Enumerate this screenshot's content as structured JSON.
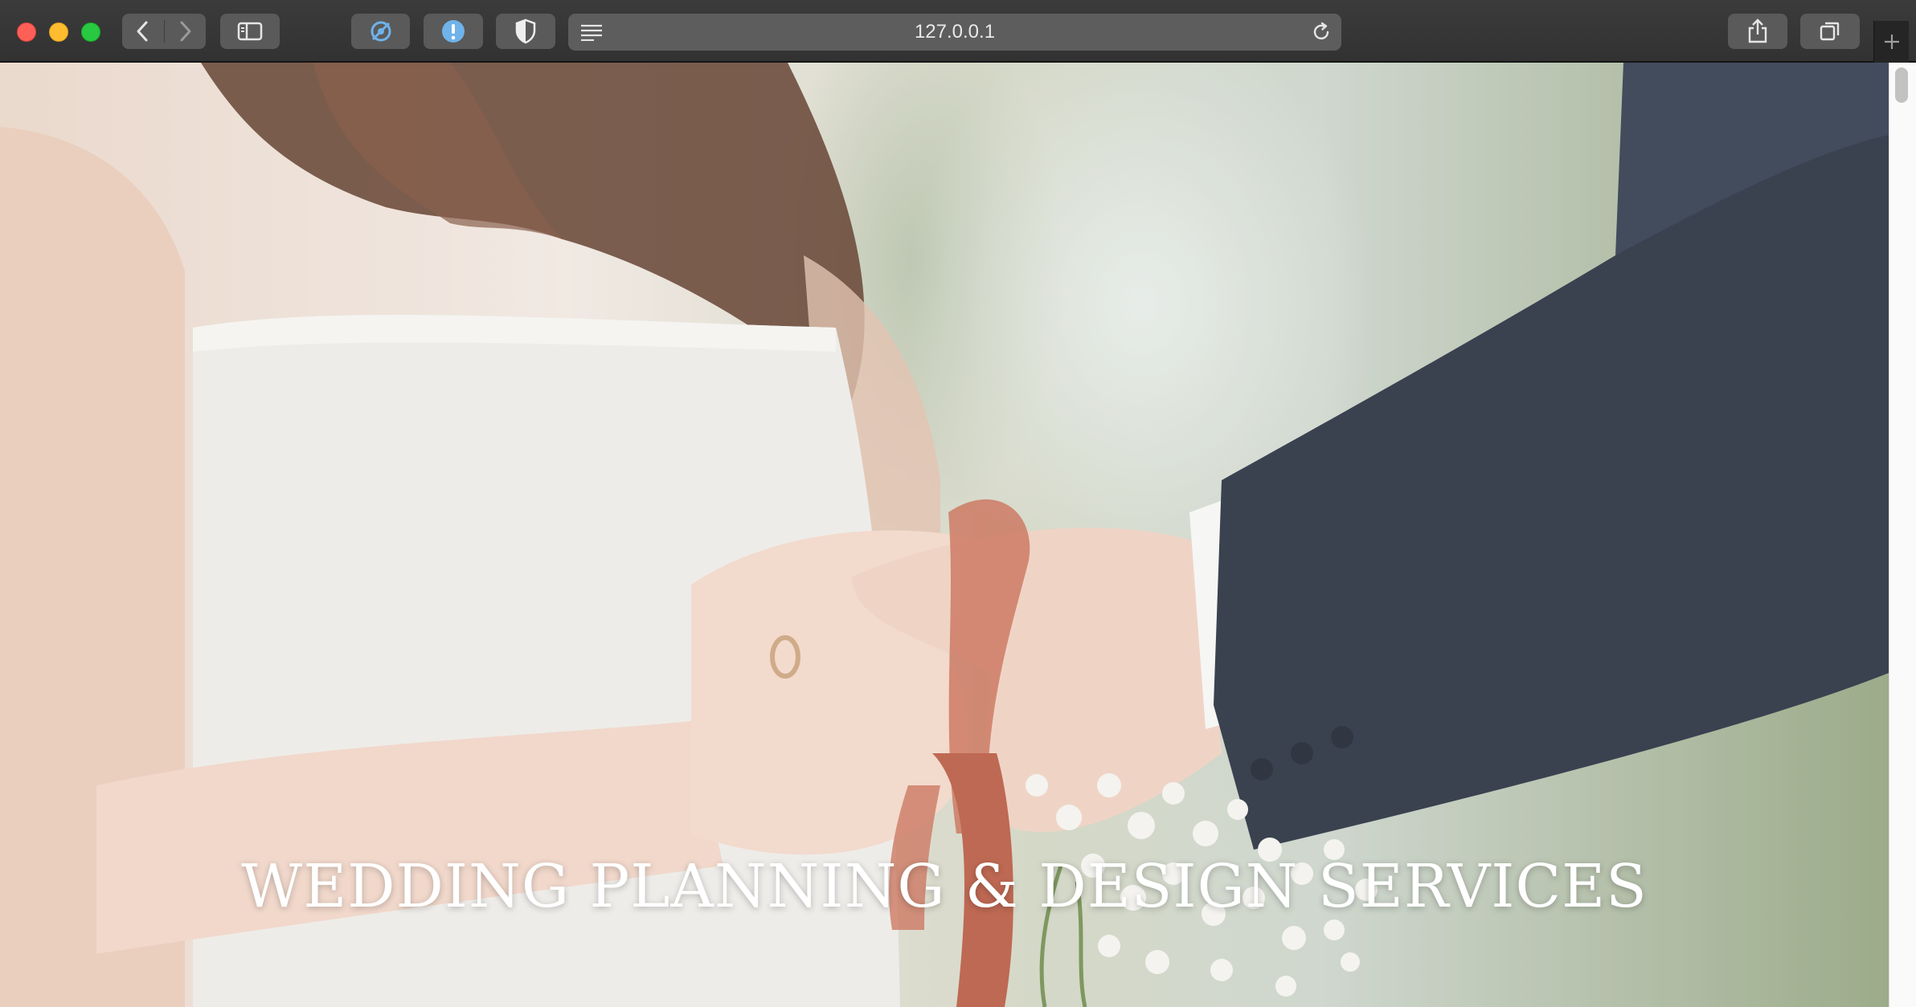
{
  "browser": {
    "url": "127.0.0.1",
    "controls": {
      "close": "close-window",
      "minimize": "minimize-window",
      "zoom": "zoom-window"
    },
    "icons": [
      "back-icon",
      "forward-icon",
      "sidebar-icon",
      "extension-icon",
      "alert-icon",
      "shield-icon",
      "reader-icon",
      "reload-icon",
      "share-icon",
      "tabs-icon",
      "new-tab-icon"
    ]
  },
  "hero": {
    "title": "WEDDING PLANNING & DESIGN SERVICES"
  }
}
